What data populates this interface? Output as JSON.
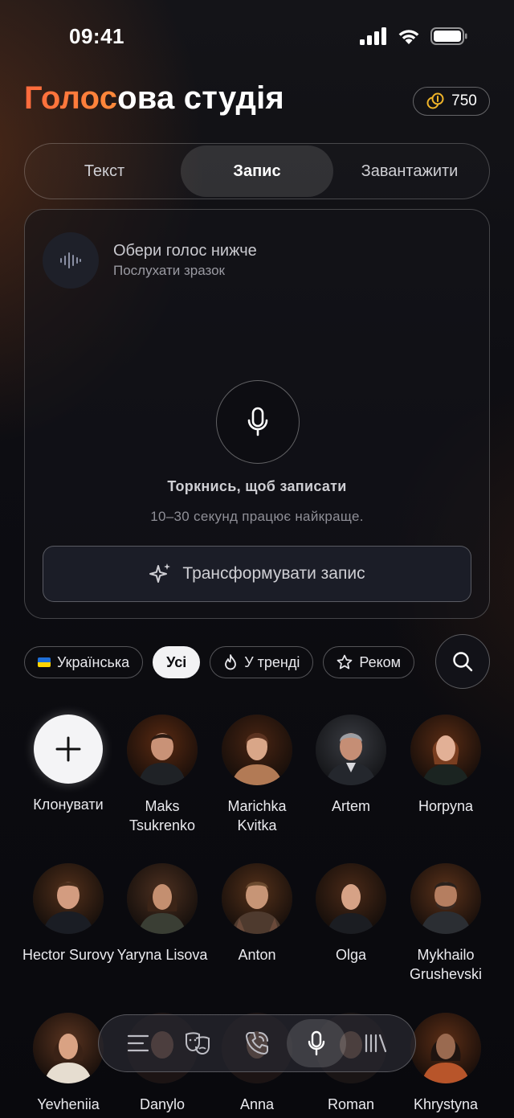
{
  "status": {
    "time": "09:41"
  },
  "header": {
    "title_accent": "Голос",
    "title_rest": "ова студія",
    "credits": "750"
  },
  "tabs": [
    {
      "label": "Текст",
      "active": false
    },
    {
      "label": "Запис",
      "active": true
    },
    {
      "label": "Завантажити",
      "active": false
    }
  ],
  "recorder": {
    "voice_title": "Обери голос нижче",
    "voice_subtitle": "Послухати зразок",
    "tap_label": "Торкнись, щоб записати",
    "hint": "10–30 секунд працює найкраще.",
    "transform_label": "Трансформувати запис"
  },
  "filters": [
    {
      "label": "Українська",
      "icon": "ukraine-flag-icon"
    },
    {
      "label": "Усі",
      "active": true
    },
    {
      "label": "У тренді",
      "icon": "flame-icon"
    },
    {
      "label": "Реком",
      "icon": "star-icon"
    }
  ],
  "voices": {
    "clone_label": "Клонувати",
    "row1": [
      {
        "name": "Maks Tsukrenko"
      },
      {
        "name": "Marichka Kvitka"
      },
      {
        "name": "Artem"
      },
      {
        "name": "Horpyna"
      }
    ],
    "row2": [
      {
        "name": "Hector Surovy"
      },
      {
        "name": "Yaryna Lisova"
      },
      {
        "name": "Anton"
      },
      {
        "name": "Olga"
      },
      {
        "name": "Mykhailo Grushevski"
      }
    ],
    "row3": [
      {
        "name": "Yevheniia"
      },
      {
        "name": "Danylo"
      },
      {
        "name": "Anna"
      },
      {
        "name": "Roman"
      },
      {
        "name": "Khrystyna"
      }
    ]
  },
  "bottom_nav": [
    {
      "icon": "menu-lines-icon"
    },
    {
      "icon": "theater-masks-icon"
    },
    {
      "icon": "phone-call-icon"
    },
    {
      "icon": "microphone-icon",
      "active": true
    },
    {
      "icon": "library-icon"
    }
  ],
  "colors": {
    "accent": "#ff6a3d",
    "background": "#0d0d12",
    "coin": "#f0b429"
  }
}
